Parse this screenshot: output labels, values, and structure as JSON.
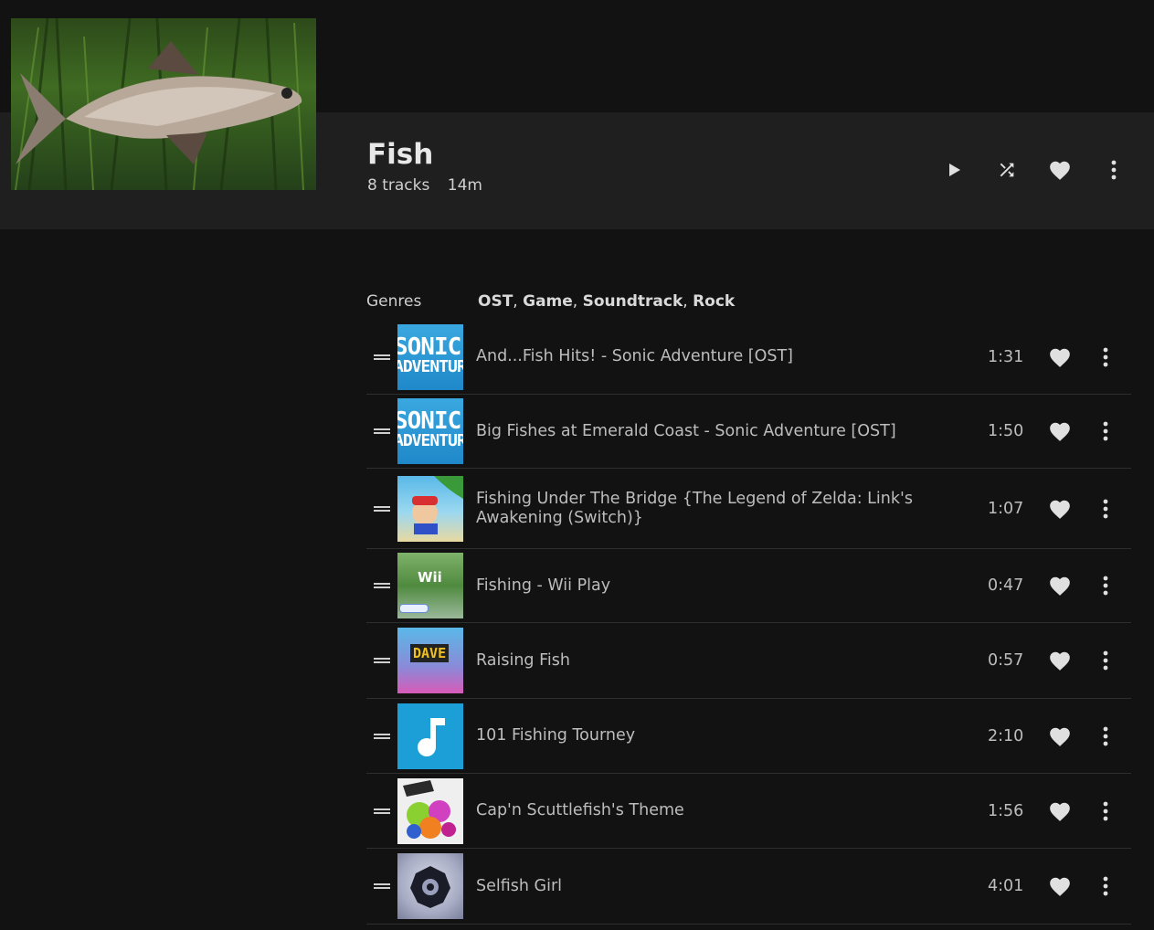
{
  "playlist": {
    "title": "Fish",
    "track_count": "8 tracks",
    "duration": "14m"
  },
  "header_actions": {
    "play_icon": "play-icon",
    "shuffle_icon": "shuffle-icon",
    "heart_icon": "heart-icon",
    "more_icon": "more-vertical-icon"
  },
  "genres": {
    "label": "Genres",
    "items": [
      "OST",
      "Game",
      "Soundtrack",
      "Rock"
    ]
  },
  "tracks": [
    {
      "name": "And...Fish Hits! - Sonic Adventure [OST]",
      "duration": "1:31",
      "art": "sonic",
      "art_text_1": "SONIC",
      "art_text_2": "ADVENTURE"
    },
    {
      "name": "Big Fishes at Emerald Coast - Sonic Adventure [OST]",
      "duration": "1:50",
      "art": "sonic",
      "art_text_1": "SONIC",
      "art_text_2": "ADVENTURE"
    },
    {
      "name": "Fishing Under The Bridge {The Legend of Zelda: Link's Awakening (Switch)}",
      "duration": "1:07",
      "art": "zelda"
    },
    {
      "name": "Fishing - Wii Play",
      "duration": "0:47",
      "art": "wii",
      "art_text_1": "Wii"
    },
    {
      "name": "Raising Fish",
      "duration": "0:57",
      "art": "dave",
      "art_text_1": "DAVE"
    },
    {
      "name": "101 Fishing Tourney",
      "duration": "2:10",
      "art": "note"
    },
    {
      "name": "Cap'n Scuttlefish's Theme",
      "duration": "1:56",
      "art": "splat"
    },
    {
      "name": "Selfish Girl",
      "duration": "4:01",
      "art": "selfish"
    }
  ],
  "colors": {
    "background": "#121212",
    "header_band": "#1f1f1f",
    "text": "#bdbdbd",
    "icon": "#e0e0e0"
  }
}
